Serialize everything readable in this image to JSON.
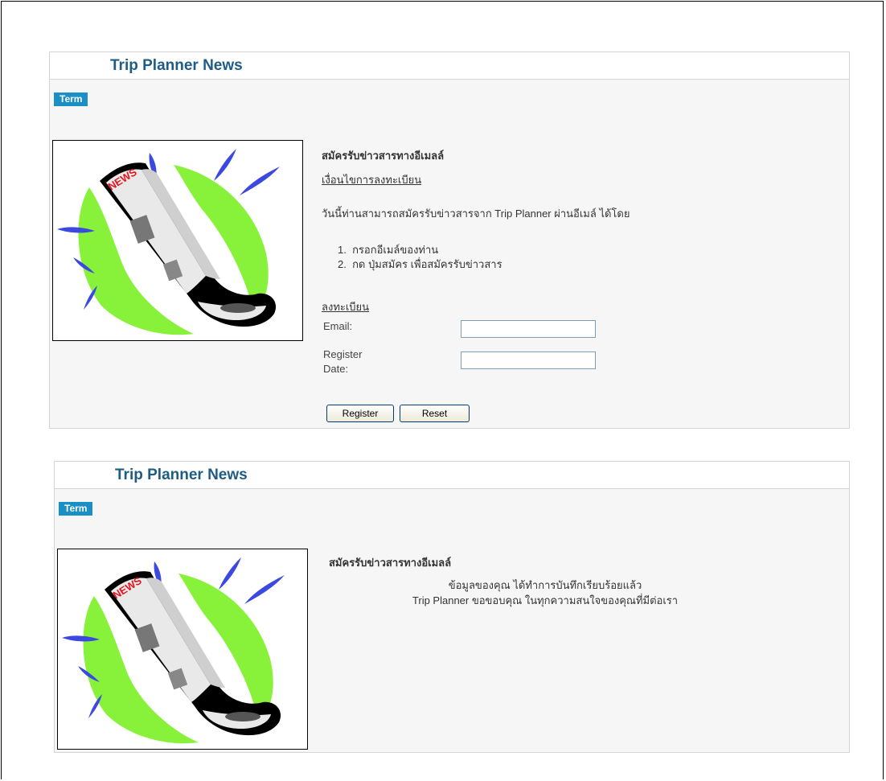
{
  "panel1": {
    "title": "Trip Planner News",
    "tab": "Term",
    "heading": "สมัครรับข่าวสารทางอีเมลล์",
    "terms_link": "เงื่อนไขการลงทะเบียน",
    "intro": "วันนี้ท่านสามารถสมัครรับข่าวสารจาก Trip Planner ผ่านอีเมล์ ได้โดย",
    "steps": [
      "1.  กรอกอีเมล์ของท่าน",
      "2.  กด ปุ่มสมัคร เพื่อสมัครรับข่าวสาร"
    ],
    "register_link": "ลงทะเบียน",
    "email_label": "Email:",
    "email_value": "",
    "date_label_1": "Register",
    "date_label_2": "Date:",
    "date_value": "",
    "register_button": "Register",
    "reset_button": "Reset"
  },
  "panel2": {
    "title": "Trip Planner News",
    "tab": "Term",
    "heading": "สมัครรับข่าวสารทางอีเมลล์",
    "message_1": "ข้อมูลของคุณ ได้ทำการบันทึกเรียบร้อยแล้ว",
    "message_2": "Trip Planner ขอขอบคุณ ในทุกความสนใจของคุณที่มีต่อเรา"
  },
  "image": {
    "icon": "newspaper-clipart",
    "lettering": "NEWS"
  },
  "colors": {
    "title": "#1f5c85",
    "tab": "#1a8fc6",
    "panel_bg": "#f6f6f6",
    "clipart_green": "#88f23a",
    "clipart_blue": "#3b49e0",
    "clipart_red": "#e8131f"
  }
}
